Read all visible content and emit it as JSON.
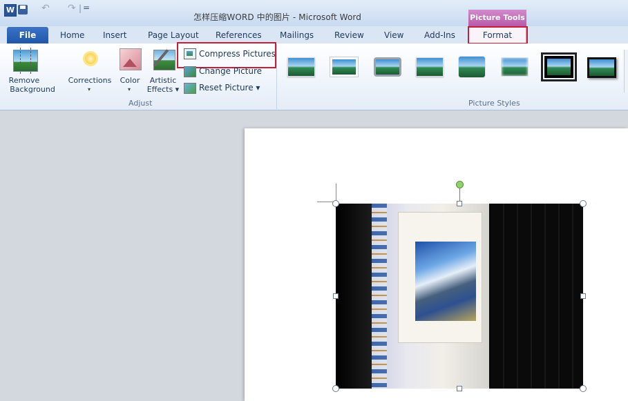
{
  "window": {
    "title": "怎样压缩WORD 中的图片 - Microsoft Word",
    "app_icon_letter": "W",
    "context_tab_header": "Picture Tools",
    "format_tab_highlight_color": "#c41e3a"
  },
  "quick_access": {
    "icons": [
      "word-icon",
      "save-icon",
      "undo-icon",
      "redo-icon",
      "customize-qat-icon"
    ],
    "undo_glyph": "↶",
    "redo_glyph": "↷",
    "separator": "|",
    "customize_glyph": "="
  },
  "tabs": {
    "file": "File",
    "home": "Home",
    "insert": "Insert",
    "page_layout": "Page Layout",
    "references": "References",
    "mailings": "Mailings",
    "review": "Review",
    "view": "View",
    "add_ins": "Add-Ins",
    "format": "Format"
  },
  "ribbon": {
    "adjust": {
      "label": "Adjust",
      "remove_background": [
        "Remove",
        "Background"
      ],
      "corrections": "Corrections",
      "color": "Color",
      "artistic_effects": [
        "Artistic",
        "Effects ▾"
      ],
      "compress_pictures": "Compress Pictures",
      "change_picture": "Change Picture",
      "reset_picture": "Reset Picture ▾",
      "dropdown_arrow": "▾"
    },
    "picture_styles": {
      "label": "Picture Styles",
      "gallery_icon_names": [
        "simple-frame-white",
        "beveled-matte-white",
        "metal-frame",
        "drop-shadow-rectangle",
        "reflected-rounded-rectangle",
        "soft-edge-rectangle",
        "double-frame-black",
        "thick-matte-black"
      ],
      "selected_index": 6
    }
  },
  "colors": {
    "accent_highlight": "#c41e3a",
    "context_tab": "#b95aab",
    "file_tab": "#2a62b8",
    "rotate_handle": "#8fd46b"
  }
}
